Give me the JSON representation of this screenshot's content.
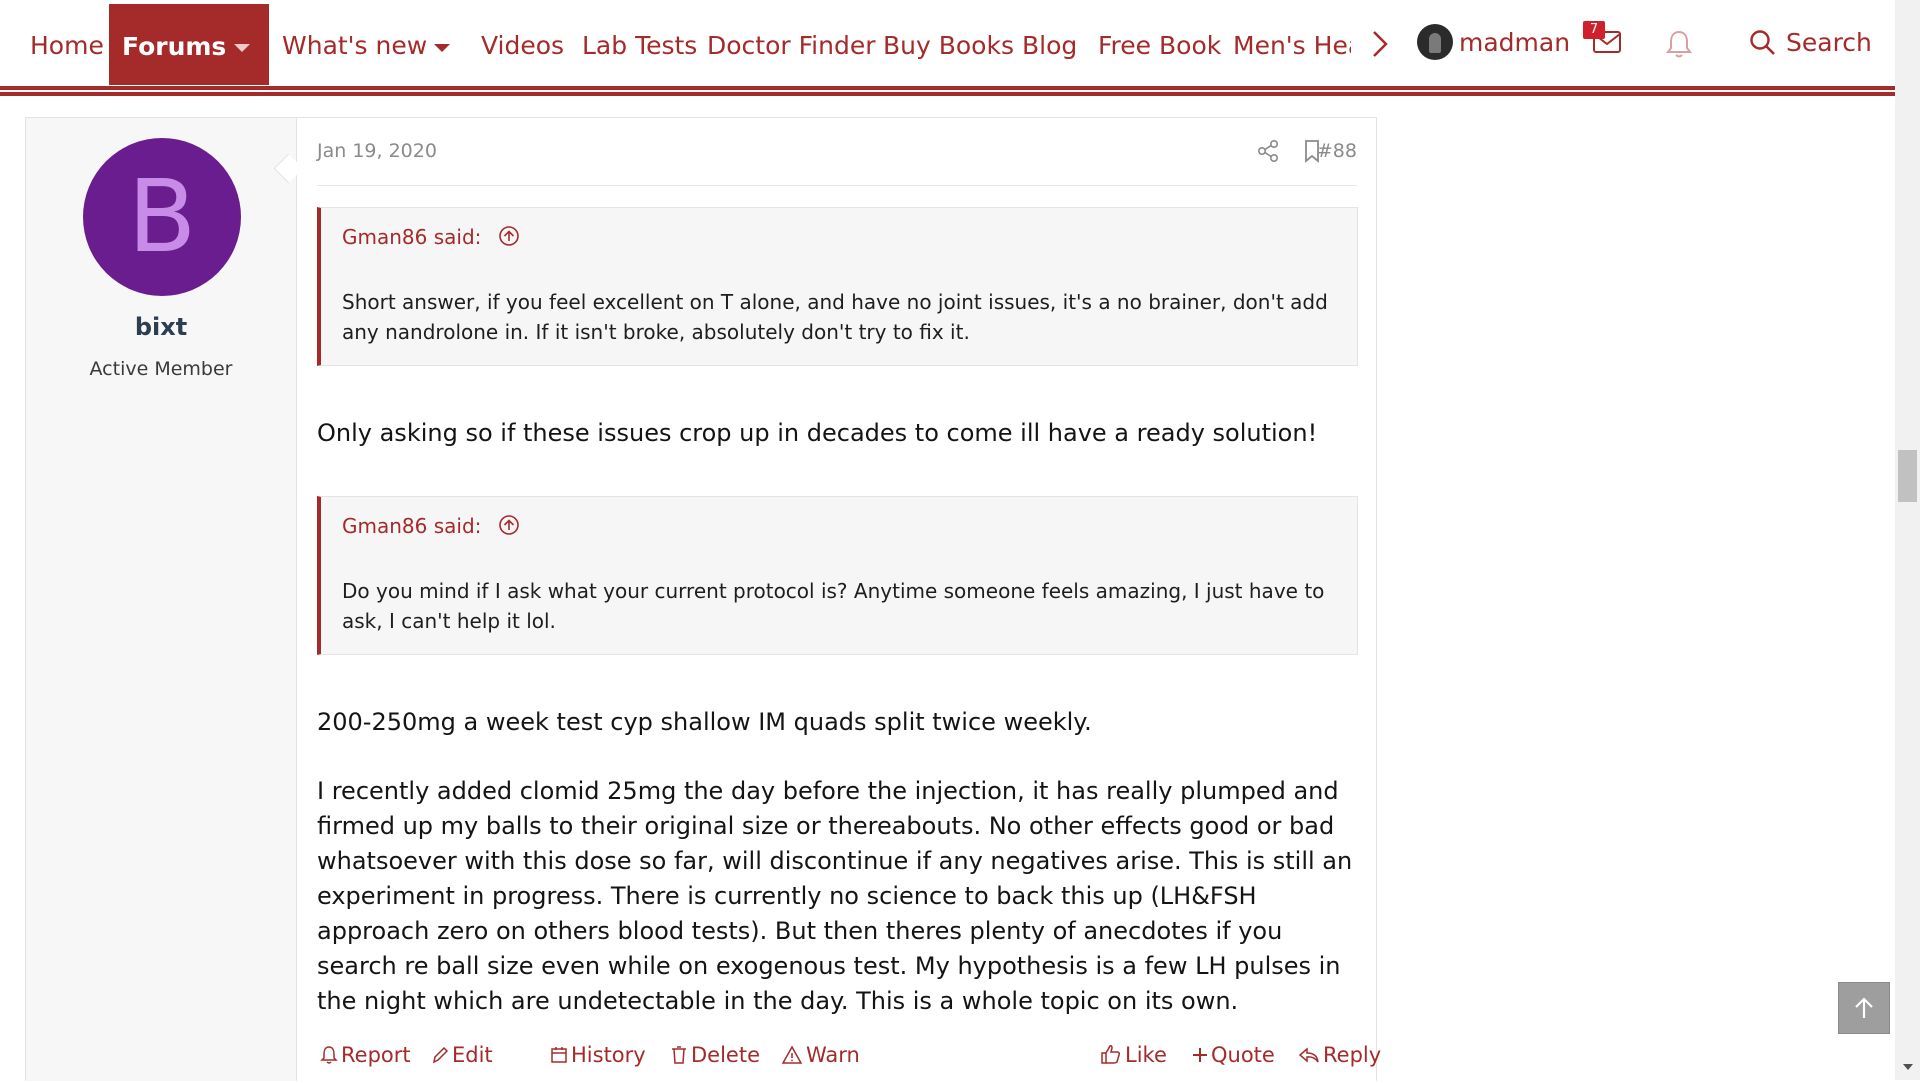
{
  "nav": {
    "items": [
      "Home",
      "Forums",
      "What's new",
      "Videos",
      "Lab Tests",
      "Doctor Finder",
      "Buy Books",
      "Blog",
      "Free Book",
      "Men's Health"
    ],
    "username": "madman",
    "message_count": "7",
    "search_label": "Search",
    "icons": [
      "forums-dropdown-caret",
      "whats-new-dropdown-caret",
      "chevron-right-icon",
      "user-avatar",
      "envelope-icon",
      "bell-icon",
      "search-icon"
    ],
    "accent_color": "#a52a2a"
  },
  "post": {
    "author": {
      "initial": "B",
      "name": "bixt",
      "title": "Active Member",
      "avatar_color": "#6a1d8e"
    },
    "date": "Jan 19, 2020",
    "number": "#88",
    "quotes": [
      {
        "author": "Gman86 said:",
        "text": "Short answer, if you feel excellent on T alone, and have no joint issues, it's a no brainer, don't add any nandrolone in. If it isn't broke, absolutely don't try to fix it."
      },
      {
        "author": "Gman86 said:",
        "text": "Do you mind if I ask what your current protocol is? Anytime someone feels amazing, I just have to ask, I can't help it lol."
      }
    ],
    "paragraphs": [
      "Only asking so if these issues crop up in decades to come ill have a ready solution!",
      "200-250mg a week test cyp shallow IM quads split twice weekly.",
      "I recently added clomid 25mg the day before the injection, it has really plumped and firmed up my balls to their original size or thereabouts. No other effects good or bad whatsoever with this dose so far, will discontinue if any negatives arise. This is still an experiment in progress. There is currently no science to back this up (LH&FSH approach zero on others blood tests). But then theres plenty of anecdotes if you search re ball size even while on exogenous test. My hypothesis is a few LH pulses in the night which are undetectable in the day. This is a whole topic on its own."
    ],
    "actions_left": [
      "Report",
      "Edit",
      "History",
      "Delete",
      "Warn"
    ],
    "actions_right": [
      "Like",
      "Quote",
      "Reply"
    ]
  }
}
